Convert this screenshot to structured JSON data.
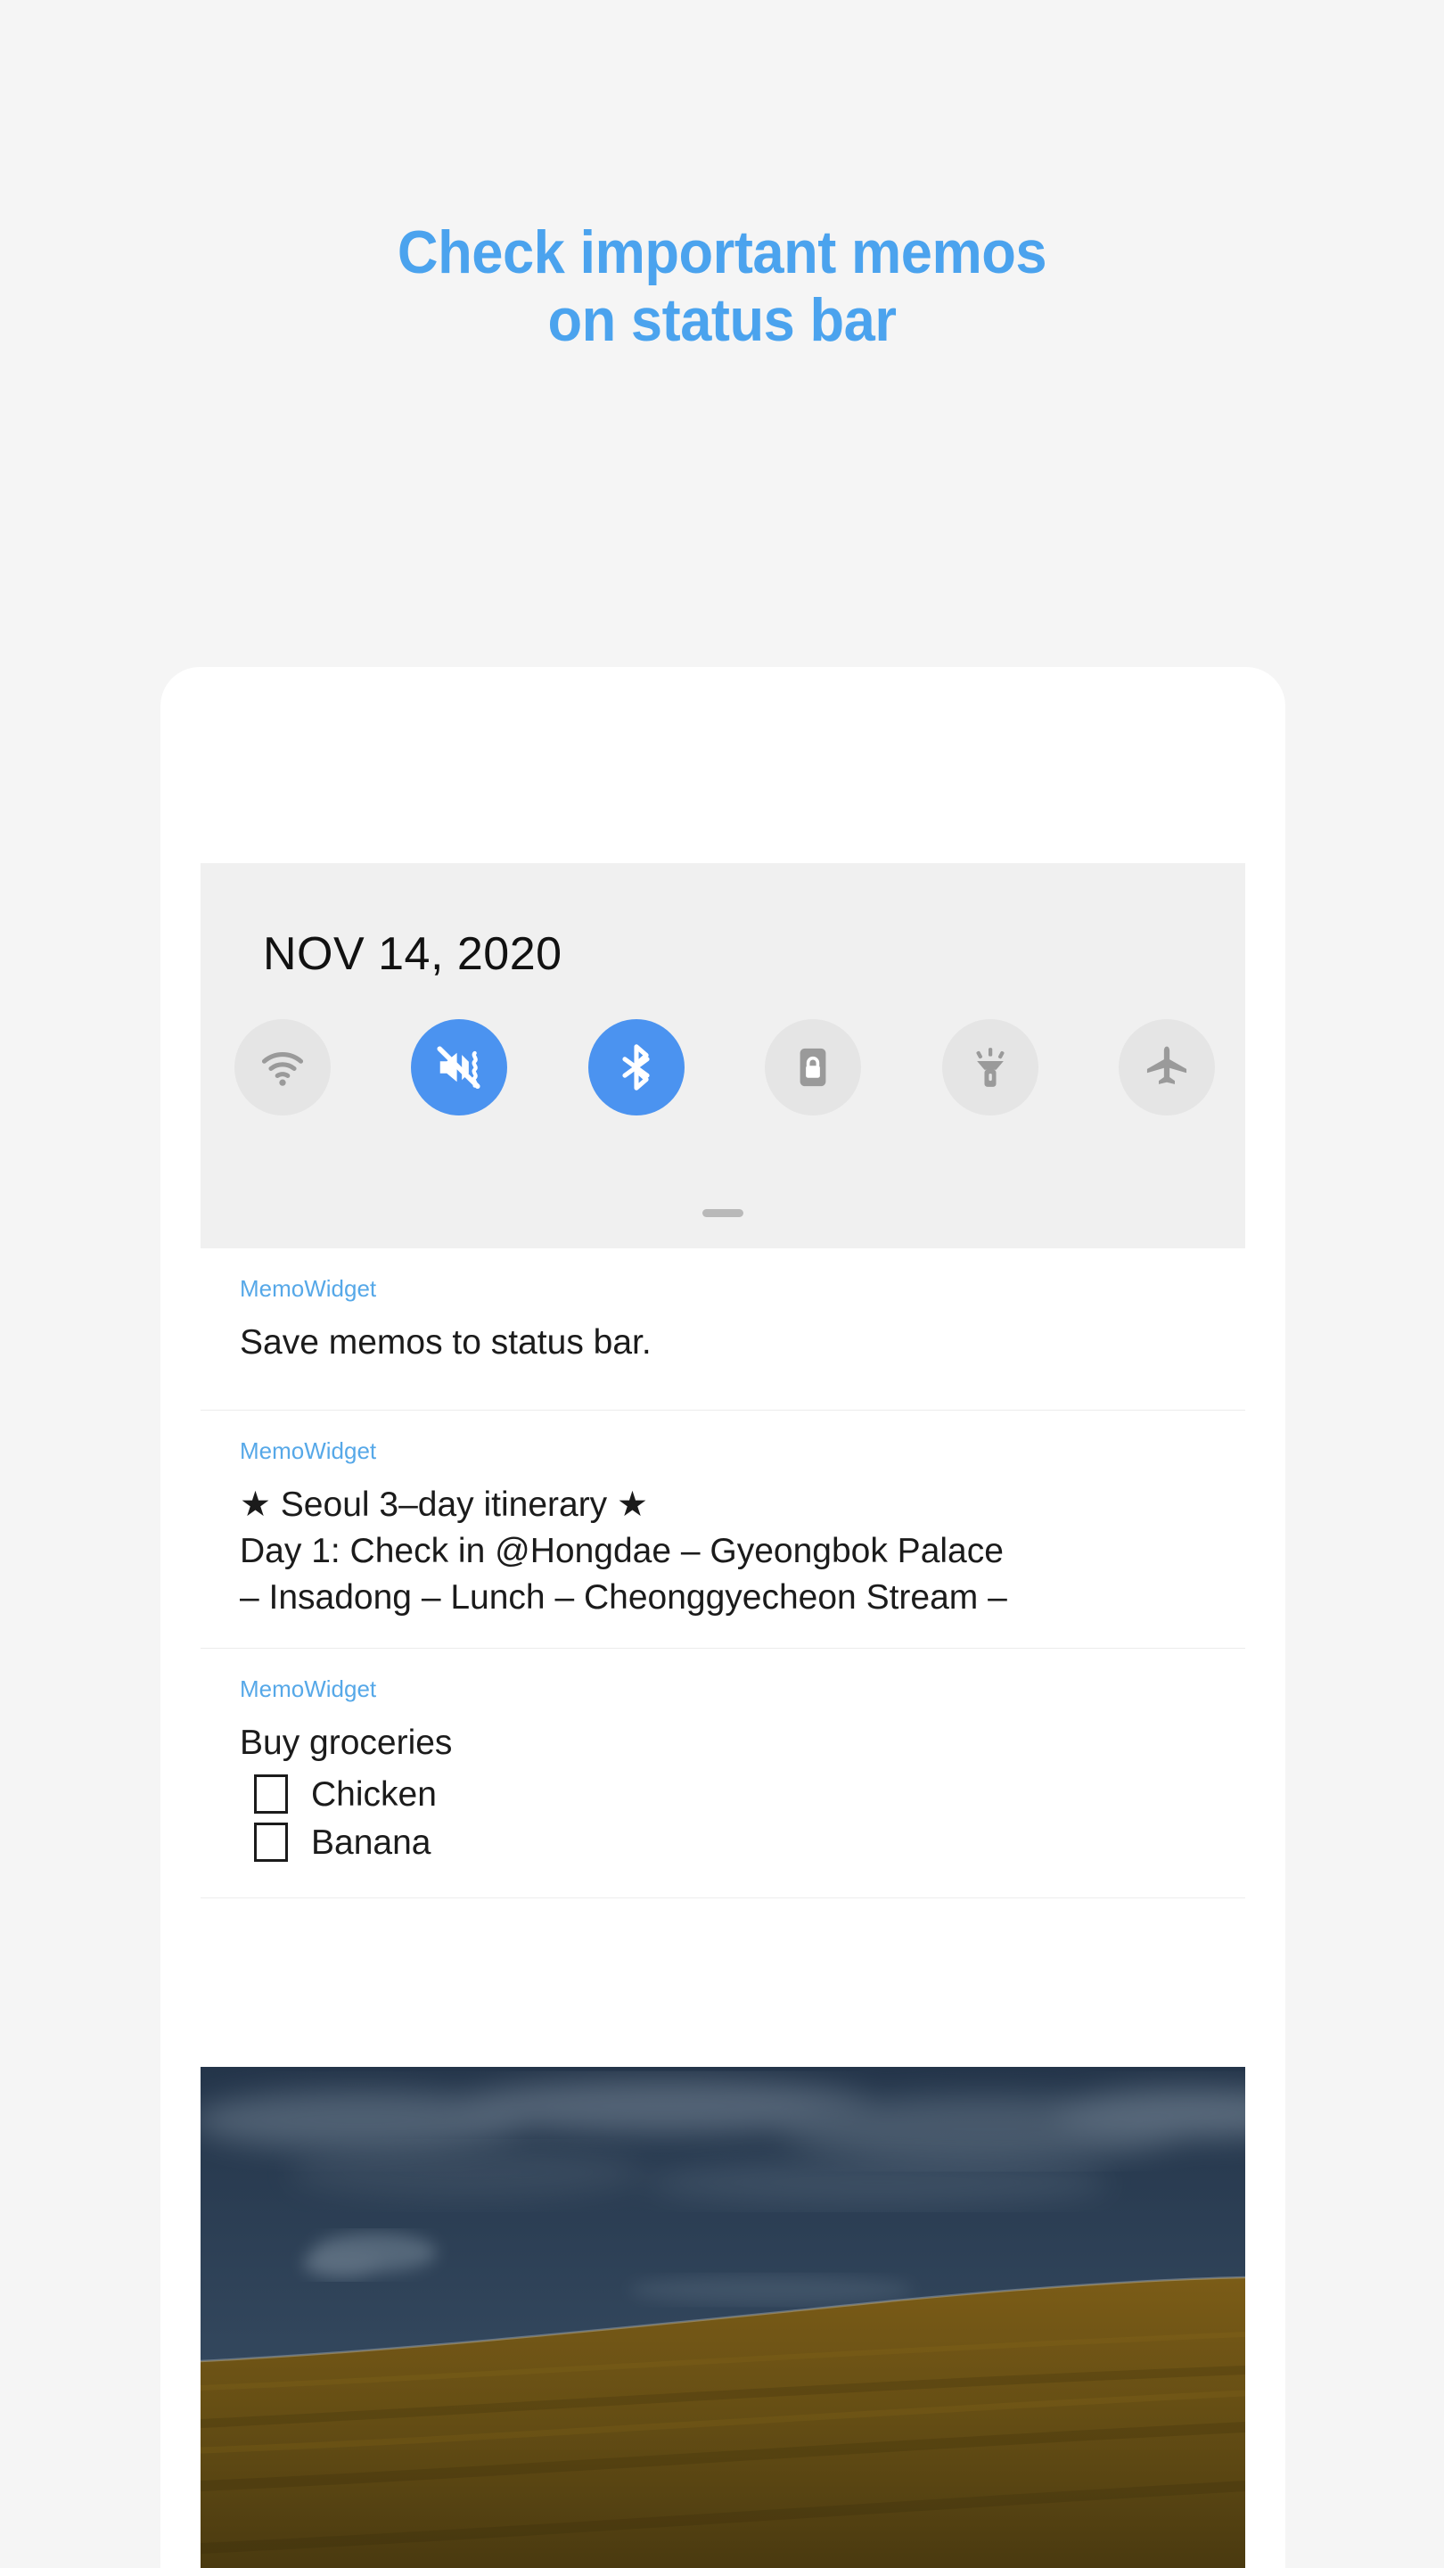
{
  "headline": {
    "line1": "Check important memos",
    "line2": "on status bar",
    "color": "#4BA3EE"
  },
  "colors": {
    "page_background": "#F5F5F5",
    "panel_background": "#F0F0F0",
    "accent_blue": "#4B93F0",
    "app_name_blue": "#56A8E8",
    "toggle_off": "#E5E5E5",
    "toggle_icon_gray": "#9A9A9A",
    "text_primary": "#1B1B1B",
    "divider": "#ECECEC"
  },
  "status_panel": {
    "date": "NOV 14, 2020",
    "toggles": [
      {
        "name": "wifi",
        "icon": "wifi-icon",
        "active": false
      },
      {
        "name": "sound-vibrate",
        "icon": "mute-vibrate-icon",
        "active": true
      },
      {
        "name": "bluetooth",
        "icon": "bluetooth-icon",
        "active": true
      },
      {
        "name": "auto-rotate-lock",
        "icon": "rotation-lock-icon",
        "active": false
      },
      {
        "name": "flashlight",
        "icon": "flashlight-icon",
        "active": false
      },
      {
        "name": "airplane-mode",
        "icon": "airplane-icon",
        "active": false
      }
    ],
    "drag_handle": "drag-handle"
  },
  "notifications": [
    {
      "app": "MemoWidget",
      "body": "Save memos to status bar."
    },
    {
      "app": "MemoWidget",
      "body": "★ Seoul 3–day itinerary ★\nDay 1: Check in @Hongdae – Gyeongbok Palace\n– Insadong – Lunch – Cheonggyecheon Stream –"
    },
    {
      "app": "MemoWidget",
      "title": "Buy groceries",
      "checklist": [
        {
          "label": "Chicken",
          "checked": false
        },
        {
          "label": "Banana",
          "checked": false
        }
      ]
    }
  ],
  "wallpaper": {
    "description": "photo of dark blue cloudy sky over golden field",
    "sky_color": "#2C3C50",
    "field_color": "#6E5416"
  }
}
